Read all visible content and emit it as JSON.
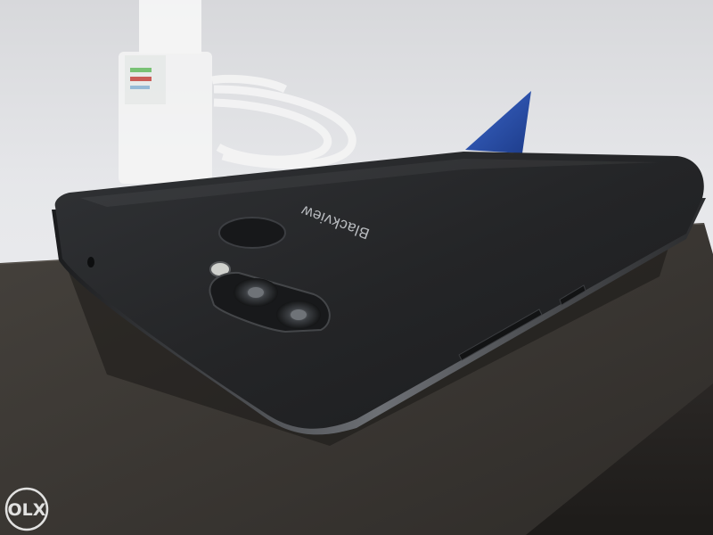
{
  "phone": {
    "brand": "Blackview"
  },
  "watermark": {
    "text": "OLX"
  },
  "colors": {
    "background": "#e9eaec",
    "phone_body": "#222325",
    "box": "#3a3733",
    "flag": "#2a4a9c"
  }
}
